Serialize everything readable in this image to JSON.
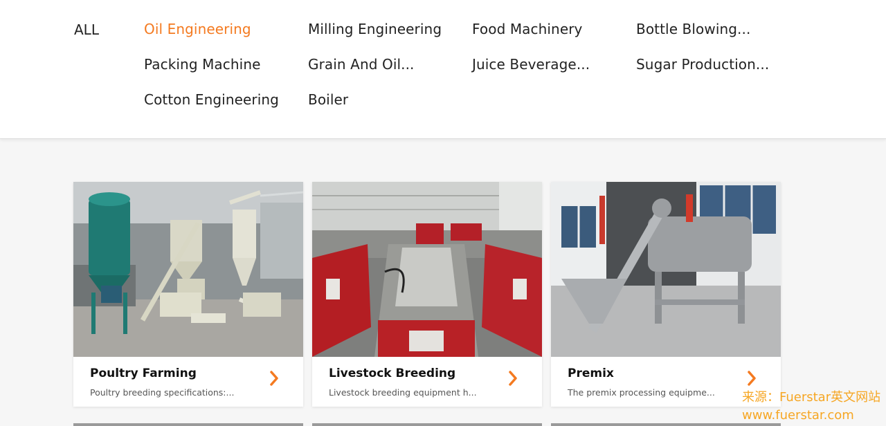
{
  "categories": {
    "all_label": "ALL",
    "items": [
      {
        "label": "Oil Engineering",
        "active": true
      },
      {
        "label": "Milling Engineering"
      },
      {
        "label": "Food Machinery"
      },
      {
        "label": "Bottle Blowing..."
      },
      {
        "label": "Packing Machine"
      },
      {
        "label": "Grain And Oil..."
      },
      {
        "label": "Juice Beverage..."
      },
      {
        "label": "Sugar Production..."
      },
      {
        "label": "Cotton Engineering"
      },
      {
        "label": "Boiler"
      }
    ]
  },
  "cards": [
    {
      "title": "Poultry Farming",
      "desc": "Poultry breeding specifications:..."
    },
    {
      "title": "Livestock Breeding",
      "desc": "Livestock breeding equipment h..."
    },
    {
      "title": "Premix",
      "desc": "The premix processing equipme..."
    }
  ],
  "watermark": {
    "line1": "来源：Fuerstar英文网站",
    "line2": "www.fuerstar.com"
  },
  "colors": {
    "accent": "#f47a20",
    "watermark": "#f6a623"
  }
}
